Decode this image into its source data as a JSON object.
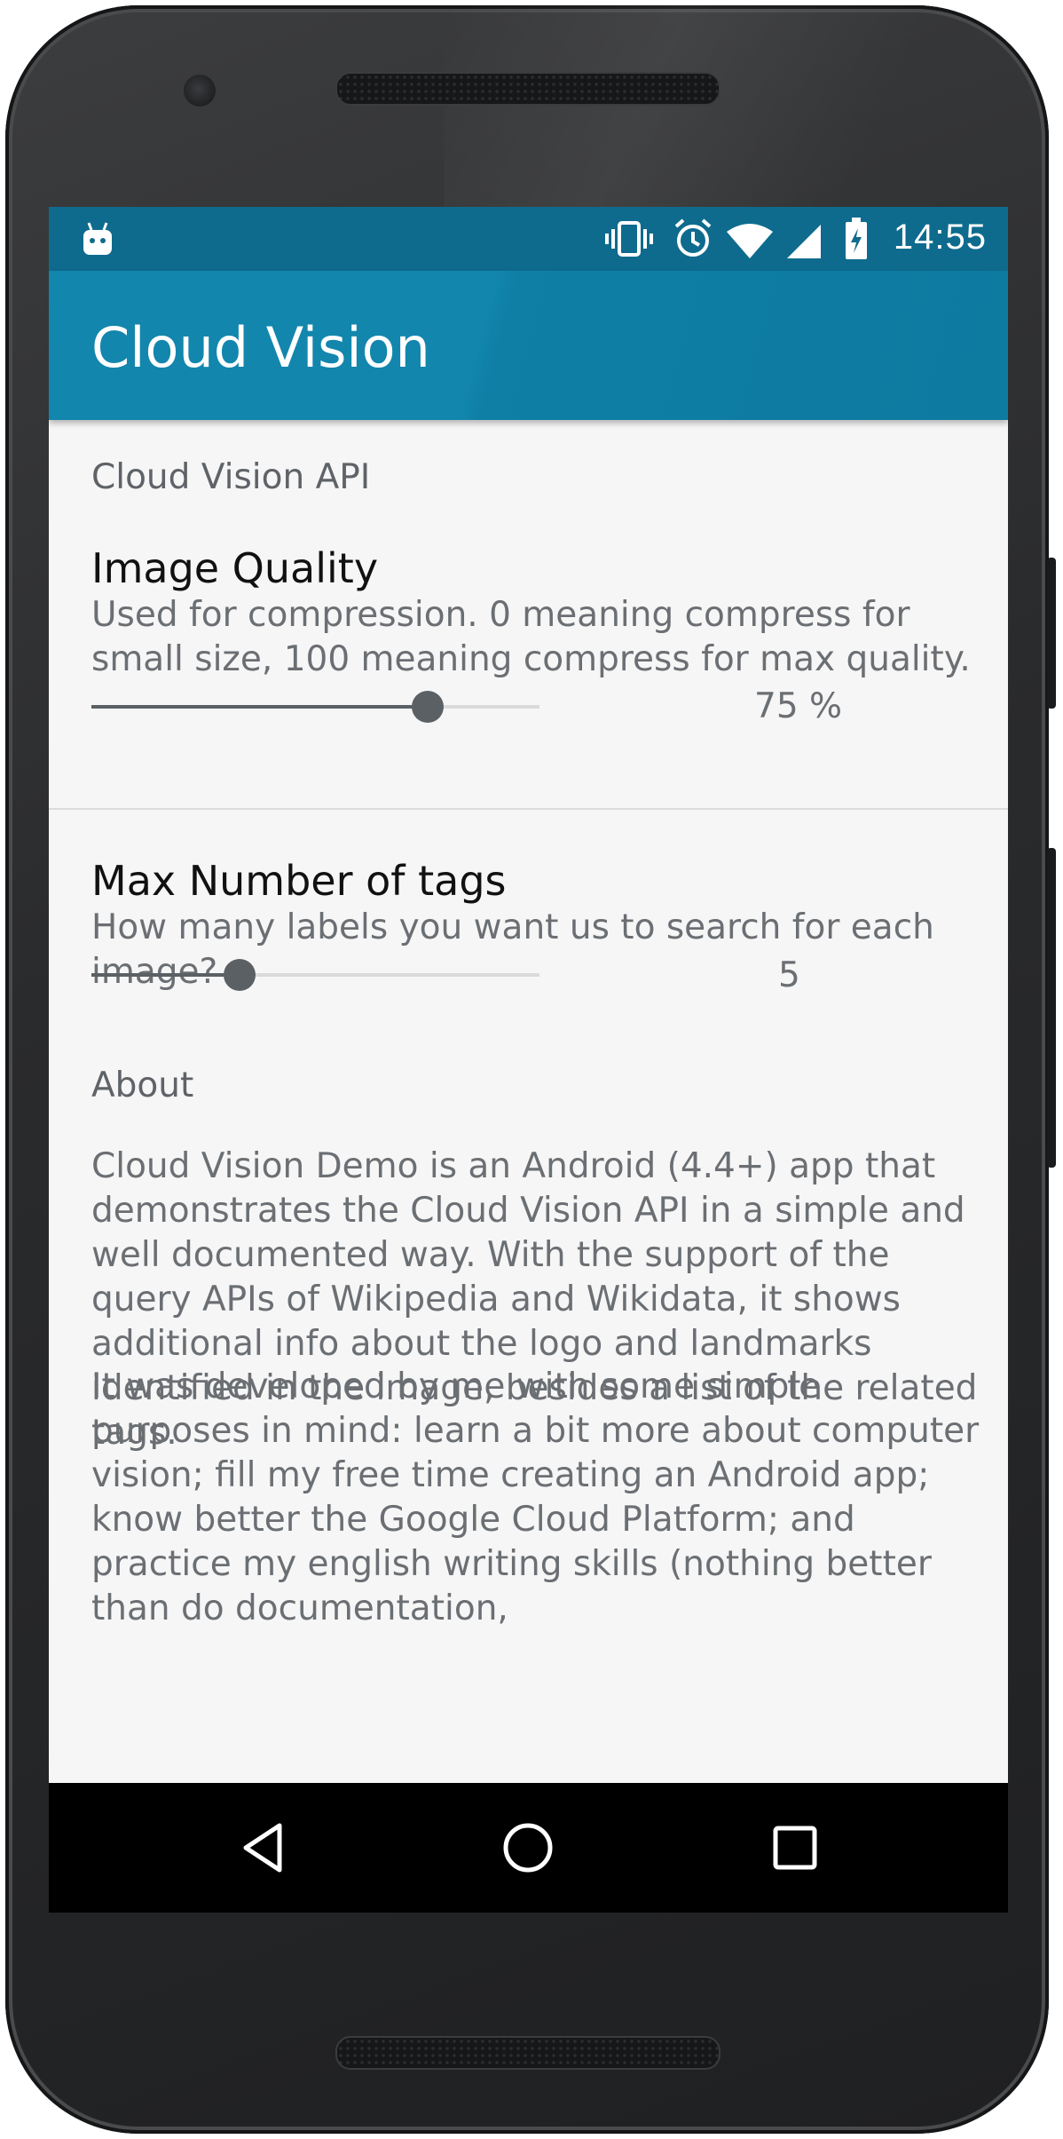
{
  "status_bar": {
    "time": "14:55",
    "icons": [
      "android-debug-icon",
      "vibrate-icon",
      "alarm-icon",
      "wifi-icon",
      "signal-icon",
      "battery-charging-icon"
    ]
  },
  "app_bar": {
    "title": "Cloud Vision"
  },
  "settings": {
    "category_api": "Cloud Vision API",
    "image_quality": {
      "title": "Image Quality",
      "summary": "Used for compression. 0 meaning compress for small size, 100 meaning compress for max quality.",
      "value_label": "75 %",
      "slider_fraction": 0.75
    },
    "max_tags": {
      "title": "Max Number of tags",
      "summary": "How many labels you want us to search for each image?",
      "value_label": "5",
      "slider_fraction": 0.33
    },
    "category_about": "About",
    "about_paragraph_1": "Cloud Vision Demo is an Android (4.4+) app that demonstrates the Cloud Vision API in a simple and well documented way. With the support of the query APIs of Wikipedia and Wikidata, it shows additional info about the logo and landmarks identified in the image, besides a list of the related tags.",
    "about_paragraph_2": "It was developed by me with some simple purposes in mind: learn a bit more about computer vision; fill my free time creating an Android app; know better the Google Cloud Platform; and practice my english writing skills (nothing better than do documentation,"
  },
  "nav_bar": {
    "icons": [
      "back-icon",
      "home-icon",
      "recents-icon"
    ]
  },
  "colors": {
    "status_bar": "#0e6b8e",
    "app_bar": "#1286ad",
    "screen_background": "#f6f6f6",
    "slider_active": "#5a6064",
    "slider_track": "#dadada"
  }
}
